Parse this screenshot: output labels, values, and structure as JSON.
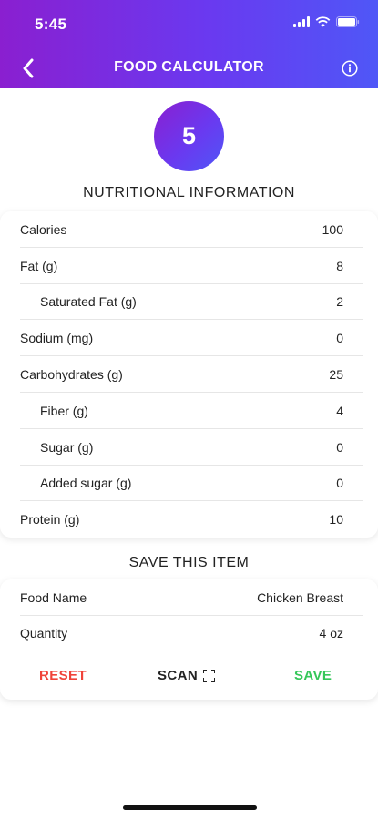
{
  "status_bar": {
    "time": "5:45"
  },
  "nav": {
    "title": "FOOD CALCULATOR",
    "back_icon": "chevron-left-icon",
    "info_icon": "info-icon"
  },
  "score": {
    "value": "5"
  },
  "nutrition": {
    "title": "NUTRITIONAL INFORMATION",
    "rows": [
      {
        "label": "Calories",
        "value": "100",
        "indent": false
      },
      {
        "label": "Fat (g)",
        "value": "8",
        "indent": false
      },
      {
        "label": "Saturated Fat (g)",
        "value": "2",
        "indent": true
      },
      {
        "label": "Sodium (mg)",
        "value": "0",
        "indent": false
      },
      {
        "label": "Carbohydrates (g)",
        "value": "25",
        "indent": false
      },
      {
        "label": "Fiber (g)",
        "value": "4",
        "indent": true
      },
      {
        "label": "Sugar (g)",
        "value": "0",
        "indent": true
      },
      {
        "label": "Added sugar (g)",
        "value": "0",
        "indent": true
      },
      {
        "label": "Protein (g)",
        "value": "10",
        "indent": false
      }
    ]
  },
  "save_item": {
    "title": "SAVE THIS ITEM",
    "food_name_label": "Food Name",
    "food_name_value": "Chicken Breast",
    "quantity_label": "Quantity",
    "quantity_value": "4 oz",
    "reset_label": "RESET",
    "scan_label": "SCAN",
    "save_label": "SAVE"
  },
  "colors": {
    "accent_gradient_start": "#8a1fd0",
    "accent_gradient_end": "#4f57f7",
    "reset": "#f0433a",
    "save": "#35c759"
  }
}
